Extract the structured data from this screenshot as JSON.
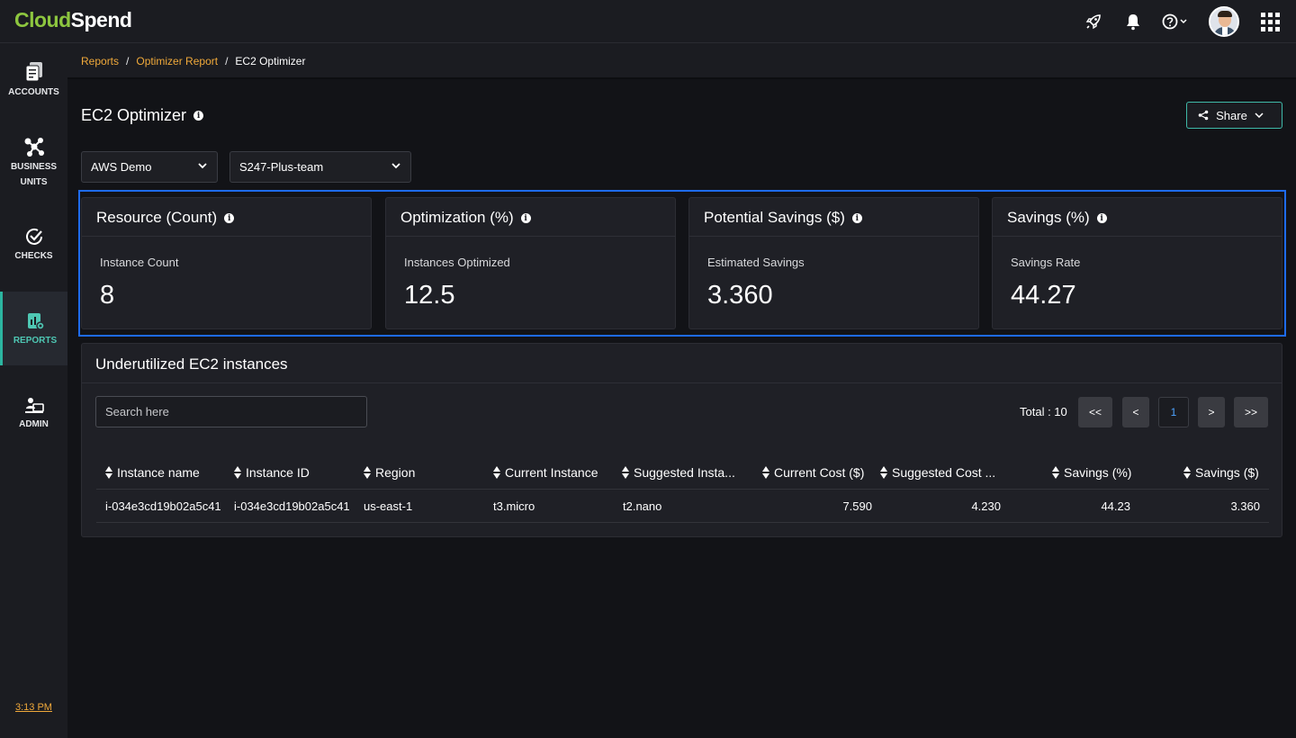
{
  "app": {
    "logo_part1": "Cloud",
    "logo_part2": "Spend"
  },
  "topbar": {
    "icons": [
      "rocket-icon",
      "bell-icon",
      "help-icon",
      "avatar",
      "apps-grid-icon"
    ]
  },
  "sidebar": {
    "items": [
      {
        "line1": "ACCOUNTS",
        "line2": "",
        "icon": "accounts-icon"
      },
      {
        "line1": "BUSINESS",
        "line2": "UNITS",
        "icon": "business-units-icon"
      },
      {
        "line1": "CHECKS",
        "line2": "",
        "icon": "checks-icon"
      },
      {
        "line1": "REPORTS",
        "line2": "",
        "icon": "reports-icon",
        "active": true
      },
      {
        "line1": "ADMIN",
        "line2": "",
        "icon": "admin-icon"
      }
    ],
    "clock": "3:13 PM"
  },
  "breadcrumb": {
    "items": [
      "Reports",
      "Optimizer Report",
      "EC2 Optimizer"
    ],
    "separator": "/"
  },
  "page": {
    "title": "EC2 Optimizer",
    "share_label": "Share"
  },
  "filters": {
    "account": "AWS Demo",
    "team": "S247-Plus-team"
  },
  "kpis": [
    {
      "title": "Resource (Count)",
      "subtitle": "Instance Count",
      "value": "8"
    },
    {
      "title": "Optimization (%)",
      "subtitle": "Instances Optimized",
      "value": "12.5"
    },
    {
      "title": "Potential Savings ($)",
      "subtitle": "Estimated Savings",
      "value": "3.360"
    },
    {
      "title": "Savings (%)",
      "subtitle": "Savings Rate",
      "value": "44.27"
    }
  ],
  "table": {
    "title": "Underutilized EC2 instances",
    "search_placeholder": "Search here",
    "total_label": "Total : 10",
    "pagination": {
      "first": "<<",
      "prev": "<",
      "page": "1",
      "next": ">",
      "last": ">>"
    },
    "columns": [
      "Instance name",
      "Instance ID",
      "Region",
      "Current Instance",
      "Suggested Insta...",
      "Current Cost ($)",
      "Suggested Cost ...",
      "Savings (%)",
      "Savings ($)"
    ],
    "rows": [
      [
        "i-034e3cd19b02a5c41",
        "i-034e3cd19b02a5c41",
        "us-east-1",
        "t3.micro",
        "t2.nano",
        "7.590",
        "4.230",
        "44.23",
        "3.360"
      ]
    ]
  }
}
